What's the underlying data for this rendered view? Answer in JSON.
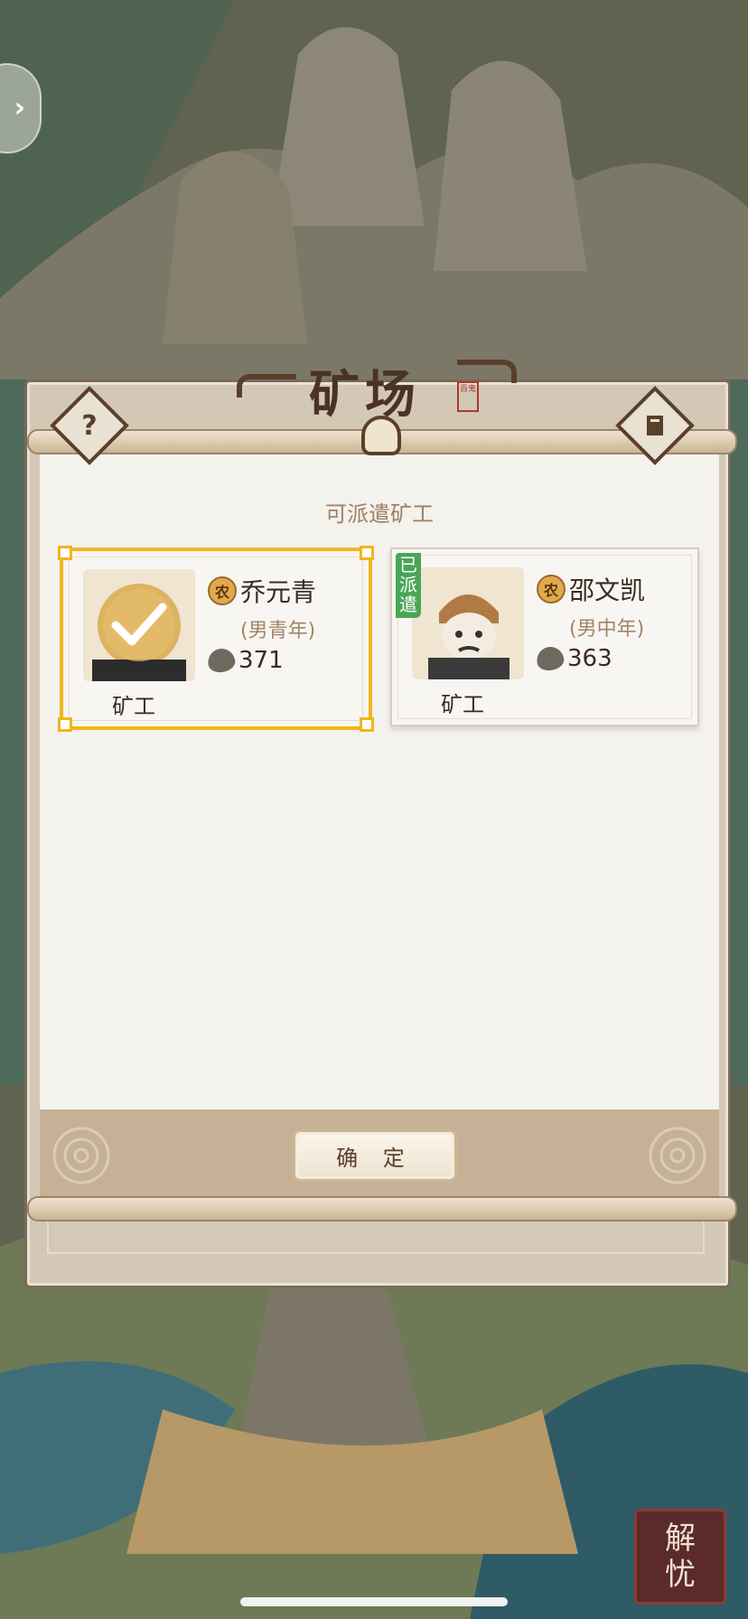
{
  "modal": {
    "title": "矿场",
    "seal_text": "百鬼",
    "subtitle": "可派遣矿工",
    "help_glyph": "?",
    "confirm_label": "确 定"
  },
  "workers": [
    {
      "badge": "农",
      "name": "乔元青",
      "desc": "(男青年)",
      "stat": "371",
      "role": "矿工",
      "selected": true,
      "dispatched_label": ""
    },
    {
      "badge": "农",
      "name": "邵文凯",
      "desc": "(男中年)",
      "stat": "363",
      "role": "矿工",
      "selected": false,
      "dispatched_label": "已派遣"
    }
  ],
  "corner_badge": {
    "line1": "解",
    "line2": "忧"
  },
  "colors": {
    "selected_border": "#f2b51c",
    "dispatched_tag": "#4aa556",
    "frame_dark": "#5a3f2b"
  },
  "icons": [
    "chevron-right-icon",
    "help-icon",
    "book-icon",
    "checkmark-icon",
    "strength-icon",
    "farmer-badge-icon"
  ]
}
